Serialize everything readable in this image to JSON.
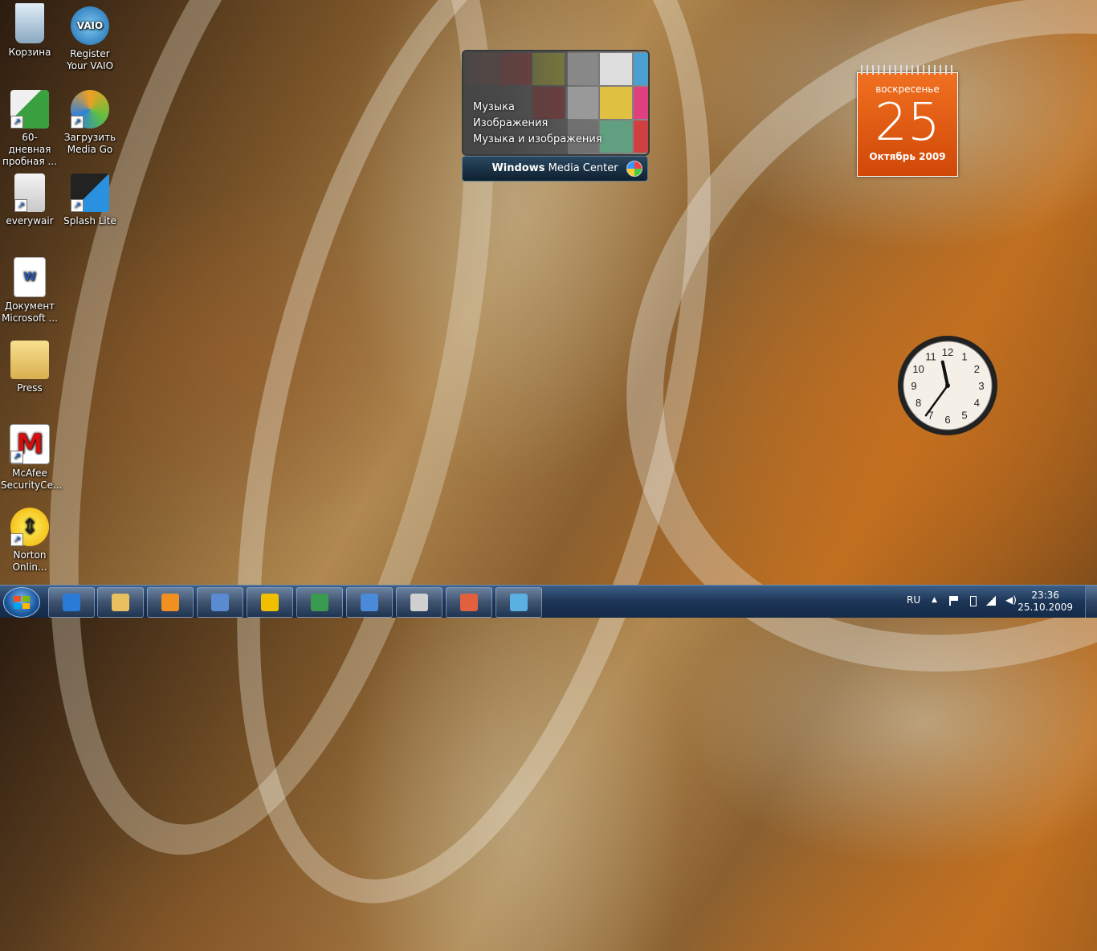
{
  "desktop": {
    "icons": [
      {
        "label": "Корзина",
        "icon": "recycle-bin-icon"
      },
      {
        "label": "Register Your VAIO",
        "icon": "vaio-registration-icon"
      },
      {
        "label": "60-дневная пробная ...",
        "icon": "office-trial-icon"
      },
      {
        "label": "Загрузить Media Go",
        "icon": "media-go-download-icon"
      },
      {
        "label": "everywair",
        "icon": "everywair-3g-icon"
      },
      {
        "label": "Splash Lite",
        "icon": "splash-lite-icon"
      },
      {
        "label": "Документ Microsoft ...",
        "icon": "word-document-icon"
      },
      {
        "label": "Press",
        "icon": "folder-icon"
      },
      {
        "label": "McAfee SecurityCe...",
        "icon": "mcafee-icon"
      },
      {
        "label": "Norton Onlin...",
        "icon": "norton-online-backup-icon"
      }
    ]
  },
  "media_center_gadget": {
    "menu": [
      "Музыка",
      "Изображения",
      "Музыка и изображения"
    ],
    "brand_bold": "Windows",
    "brand_light": " Media Center"
  },
  "calendar_gadget": {
    "day_of_week": "воскресенье",
    "day": "25",
    "month_year": "Октябрь 2009"
  },
  "clock_gadget": {
    "numbers": [
      "12",
      "1",
      "2",
      "3",
      "4",
      "5",
      "6",
      "7",
      "8",
      "9",
      "10",
      "11"
    ],
    "hour": 23,
    "minute": 36
  },
  "taskbar": {
    "pinned": [
      {
        "name": "internet-explorer",
        "icon": "internet-explorer-icon",
        "color": "#2a7ad8"
      },
      {
        "name": "windows-explorer",
        "icon": "folder-icon",
        "color": "#e8c060"
      },
      {
        "name": "media-player",
        "icon": "media-player-icon",
        "color": "#f09020"
      },
      {
        "name": "slideshow",
        "icon": "photo-slideshow-icon",
        "color": "#5a8ad0"
      },
      {
        "name": "norton",
        "icon": "norton-icon",
        "color": "#f0c000"
      },
      {
        "name": "network-tool",
        "icon": "network-users-icon",
        "color": "#3a9a50"
      },
      {
        "name": "remote-desktop",
        "icon": "remote-desktop-icon",
        "color": "#4a8ad8"
      },
      {
        "name": "movie-maker",
        "icon": "clapperboard-321-icon",
        "color": "#d0d0d0"
      },
      {
        "name": "paint",
        "icon": "paint-palette-icon",
        "color": "#e06040"
      },
      {
        "name": "photo-gallery",
        "icon": "photo-gallery-icon",
        "color": "#5ab0e0"
      }
    ],
    "tray": {
      "language": "RU",
      "time": "23:36",
      "date": "25.10.2009"
    }
  }
}
